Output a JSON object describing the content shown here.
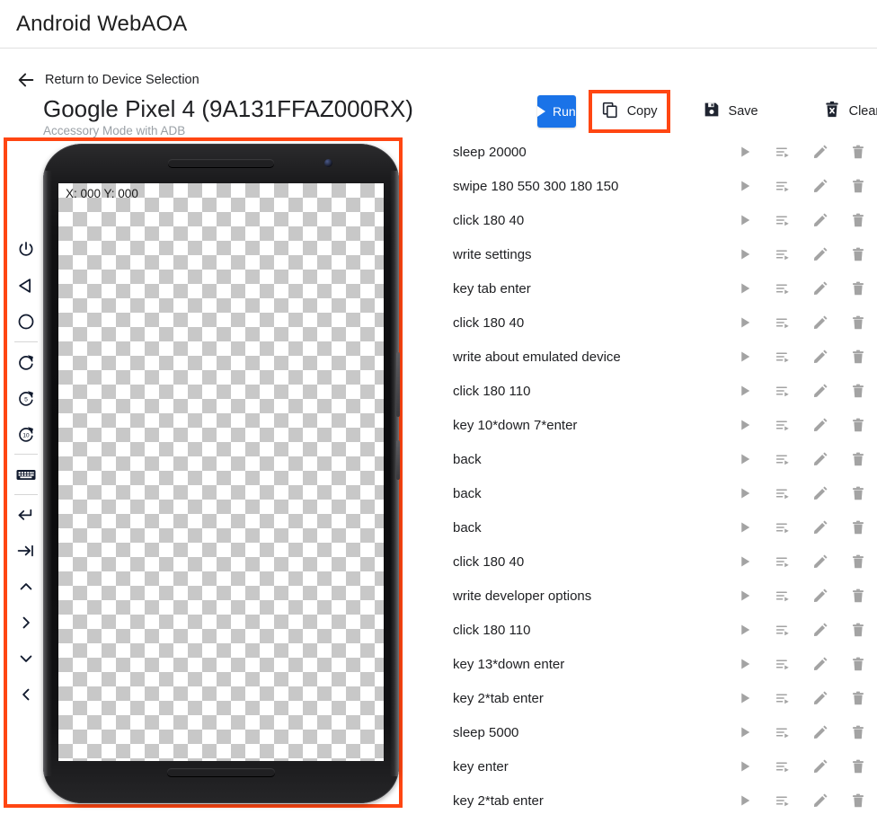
{
  "header": {
    "app_title": "Android WebAOA"
  },
  "back_link": {
    "label": "Return to Device Selection",
    "icon": "arrow-left-icon"
  },
  "device": {
    "title": "Google Pixel 4 (9A131FFAZ000RX)",
    "subtitle": "Accessory Mode with ADB",
    "coord_readout": "X: 000 Y: 000",
    "highlight_color": "#ff4612"
  },
  "rail": {
    "items": [
      {
        "name": "power-icon",
        "label": "Power"
      },
      {
        "name": "back-triangle-icon",
        "label": "Back"
      },
      {
        "name": "home-circle-icon",
        "label": "Home"
      },
      {
        "name": "refresh-icon",
        "label": "Refresh"
      },
      {
        "name": "refresh-5-icon",
        "label": "Refresh 5"
      },
      {
        "name": "refresh-10-icon",
        "label": "Refresh 10"
      },
      {
        "name": "keyboard-icon",
        "label": "Keyboard"
      },
      {
        "name": "enter-key-icon",
        "label": "Enter"
      },
      {
        "name": "tab-key-icon",
        "label": "Tab"
      },
      {
        "name": "chevron-up-icon",
        "label": "Up"
      },
      {
        "name": "chevron-right-icon",
        "label": "Right"
      },
      {
        "name": "chevron-down-icon",
        "label": "Down"
      },
      {
        "name": "chevron-left-icon",
        "label": "Left"
      }
    ]
  },
  "toolbar": {
    "run_label": "Run",
    "copy_label": "Copy",
    "save_label": "Save",
    "clear_label": "Clear",
    "run_color": "#1a73e8",
    "copy_highlight_color": "#ff4612"
  },
  "command_list": {
    "row_action_icons": [
      "play-icon",
      "play-from-here-icon",
      "edit-pencil-icon",
      "delete-trash-icon"
    ],
    "rows": [
      {
        "command": "sleep 20000"
      },
      {
        "command": "swipe 180 550 300 180 150"
      },
      {
        "command": "click 180 40"
      },
      {
        "command": "write settings"
      },
      {
        "command": "key tab enter"
      },
      {
        "command": "click 180 40"
      },
      {
        "command": "write about emulated device"
      },
      {
        "command": "click 180 110"
      },
      {
        "command": "key 10*down 7*enter"
      },
      {
        "command": "back"
      },
      {
        "command": "back"
      },
      {
        "command": "back"
      },
      {
        "command": "click 180 40"
      },
      {
        "command": "write developer options"
      },
      {
        "command": "click 180 110"
      },
      {
        "command": "key 13*down enter"
      },
      {
        "command": "key 2*tab enter"
      },
      {
        "command": "sleep 5000"
      },
      {
        "command": "key enter"
      },
      {
        "command": "key 2*tab enter"
      }
    ]
  }
}
